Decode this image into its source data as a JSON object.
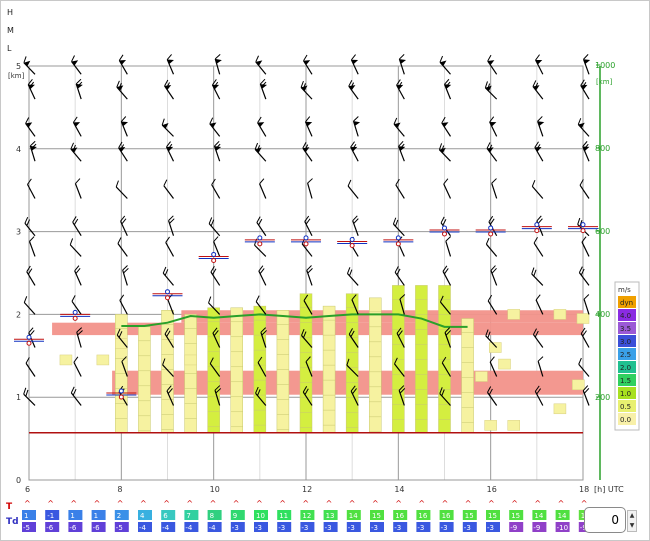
{
  "level_labels": [
    "H",
    "M",
    "L"
  ],
  "alt_unit": "[km]",
  "temp_row": {
    "t_label": "T",
    "td_label": "Td"
  },
  "spinner": {
    "value": "0"
  },
  "chart_data": {
    "type": "meteogram",
    "x_axis": {
      "label": "[h] UTC",
      "ticks": [
        "6",
        "8",
        "10",
        "12",
        "14",
        "16",
        "18"
      ],
      "range": [
        6,
        18
      ]
    },
    "y_axis_left": {
      "label": "[km]",
      "ticks": [
        "0",
        "1",
        "2",
        "3",
        "4",
        "5"
      ],
      "range": [
        0,
        5
      ]
    },
    "y_axis_right": {
      "label": "[km]",
      "ticks": [
        "200",
        "400",
        "600",
        "800",
        "1000"
      ]
    },
    "legend": {
      "title": "m/s",
      "entries": [
        {
          "label": "dyn",
          "color": "#f0a000"
        },
        {
          "label": "4.0",
          "color": "#8a2be2"
        },
        {
          "label": "3.5",
          "color": "#9b59d6"
        },
        {
          "label": "3.0",
          "color": "#3a4fd8"
        },
        {
          "label": "2.5",
          "color": "#3aa0e8"
        },
        {
          "label": "2.0",
          "color": "#20c090"
        },
        {
          "label": "1.5",
          "color": "#30d060"
        },
        {
          "label": "1.0",
          "color": "#a8e020"
        },
        {
          "label": "0.5",
          "color": "#e8f070"
        },
        {
          "label": "0.0",
          "color": "#f8f0a8"
        }
      ]
    },
    "hours": [
      6.0,
      6.5,
      7.0,
      7.5,
      8.0,
      8.5,
      9.0,
      9.5,
      10.0,
      10.5,
      11.0,
      11.5,
      12.0,
      12.5,
      13.0,
      13.5,
      14.0,
      14.5,
      15.0,
      15.5,
      16.0,
      16.5,
      17.0,
      17.5,
      18.0
    ],
    "T": [
      "1",
      "-1",
      "1",
      "1",
      "2",
      "4",
      "6",
      "7",
      "8",
      "9",
      "10",
      "11",
      "12",
      "13",
      "14",
      "15",
      "16",
      "16",
      "16",
      "15",
      "15",
      "15",
      "14",
      "14",
      "13"
    ],
    "Td": [
      "-5",
      "-6",
      "-6",
      "-6",
      "-5",
      "-4",
      "-4",
      "-4",
      "-4",
      "-3",
      "-3",
      "-3",
      "-3",
      "-3",
      "-3",
      "-3",
      "-3",
      "-3",
      "-3",
      "-3",
      "-3",
      "-9",
      "-9",
      "-10",
      "-9"
    ],
    "T_colors": [
      "#3a80e8",
      "#3a58e0",
      "#3a80e8",
      "#3a80e8",
      "#3a90e8",
      "#38b0e0",
      "#38c8c0",
      "#30d0a0",
      "#30d080",
      "#30d870",
      "#30e060",
      "#30e060",
      "#40e050",
      "#40e050",
      "#50e040",
      "#50e040",
      "#50e040",
      "#50e040",
      "#50e040",
      "#50e040",
      "#50e040",
      "#50e040",
      "#50e040",
      "#50e040",
      "#60e040"
    ],
    "Td_colors": [
      "#6040d8",
      "#6040d8",
      "#6040d8",
      "#6040d8",
      "#6040d8",
      "#3a58e0",
      "#3a58e0",
      "#3a58e0",
      "#3a58e0",
      "#3a58e0",
      "#3a58e0",
      "#3a58e0",
      "#3a58e0",
      "#3a58e0",
      "#3a58e0",
      "#3a58e0",
      "#3a58e0",
      "#3a58e0",
      "#3a58e0",
      "#3a58e0",
      "#3a58e0",
      "#9040c8",
      "#9040c8",
      "#9040c8",
      "#9040c8"
    ],
    "cloud_base_km": [
      1.7,
      1.0,
      2.0,
      2.0,
      1.05,
      2.1,
      2.25,
      2.55,
      2.7,
      2.58,
      2.9,
      2.95,
      2.9,
      2.98,
      2.88,
      2.85,
      2.9,
      2.92,
      3.02,
      3.06,
      3.02,
      3.06,
      3.06,
      3.06,
      3.06
    ],
    "thermal_top_km": [
      1.68,
      1.94,
      1.86,
      1.86,
      1.86,
      1.86,
      1.9,
      1.98,
      1.96,
      1.98,
      2.0,
      1.98,
      1.96,
      1.98,
      2.0,
      2.0,
      2.0,
      1.95,
      1.85,
      1.85,
      1.85,
      1.85,
      1.85,
      1.85,
      1.85
    ],
    "columns": [
      {
        "h": 8.0,
        "top": 2.0,
        "bot": 0.57,
        "cls": "b0"
      },
      {
        "h": 8.5,
        "top": 1.85,
        "bot": 0.57,
        "cls": "b0"
      },
      {
        "h": 9.0,
        "top": 2.05,
        "bot": 0.57,
        "cls": "b0"
      },
      {
        "h": 9.5,
        "top": 2.0,
        "bot": 0.57,
        "cls": "b0"
      },
      {
        "h": 10.0,
        "top": 2.08,
        "bot": 0.57,
        "cls": "b1"
      },
      {
        "h": 10.5,
        "top": 2.08,
        "bot": 0.57,
        "cls": "b0"
      },
      {
        "h": 11.0,
        "top": 2.1,
        "bot": 0.57,
        "cls": "b1"
      },
      {
        "h": 11.5,
        "top": 2.05,
        "bot": 0.57,
        "cls": "b0"
      },
      {
        "h": 12.0,
        "top": 2.25,
        "bot": 0.57,
        "cls": "b1"
      },
      {
        "h": 12.5,
        "top": 2.1,
        "bot": 0.57,
        "cls": "b0"
      },
      {
        "h": 13.0,
        "top": 2.25,
        "bot": 0.57,
        "cls": "b1"
      },
      {
        "h": 13.5,
        "top": 2.2,
        "bot": 0.57,
        "cls": "b0"
      },
      {
        "h": 14.0,
        "top": 2.35,
        "bot": 0.57,
        "cls": "b1"
      },
      {
        "h": 14.5,
        "top": 2.35,
        "bot": 0.57,
        "cls": "b1"
      },
      {
        "h": 15.0,
        "top": 2.35,
        "bot": 0.57,
        "cls": "b1"
      },
      {
        "h": 15.5,
        "top": 1.95,
        "bot": 0.57,
        "cls": "b0"
      }
    ],
    "bands": [
      {
        "x0": 6.5,
        "x1": 18.0,
        "y0": 1.75,
        "y1": 1.9
      },
      {
        "x0": 7.8,
        "x1": 18.0,
        "y0": 1.03,
        "y1": 1.32
      },
      {
        "x0": 9.3,
        "x1": 18.0,
        "y0": 1.9,
        "y1": 2.05
      }
    ],
    "wind_levels_km": [
      0.9,
      1.25,
      1.6,
      2.0,
      2.35,
      2.7,
      2.95,
      3.4,
      3.85,
      4.15,
      4.6,
      4.9
    ]
  }
}
